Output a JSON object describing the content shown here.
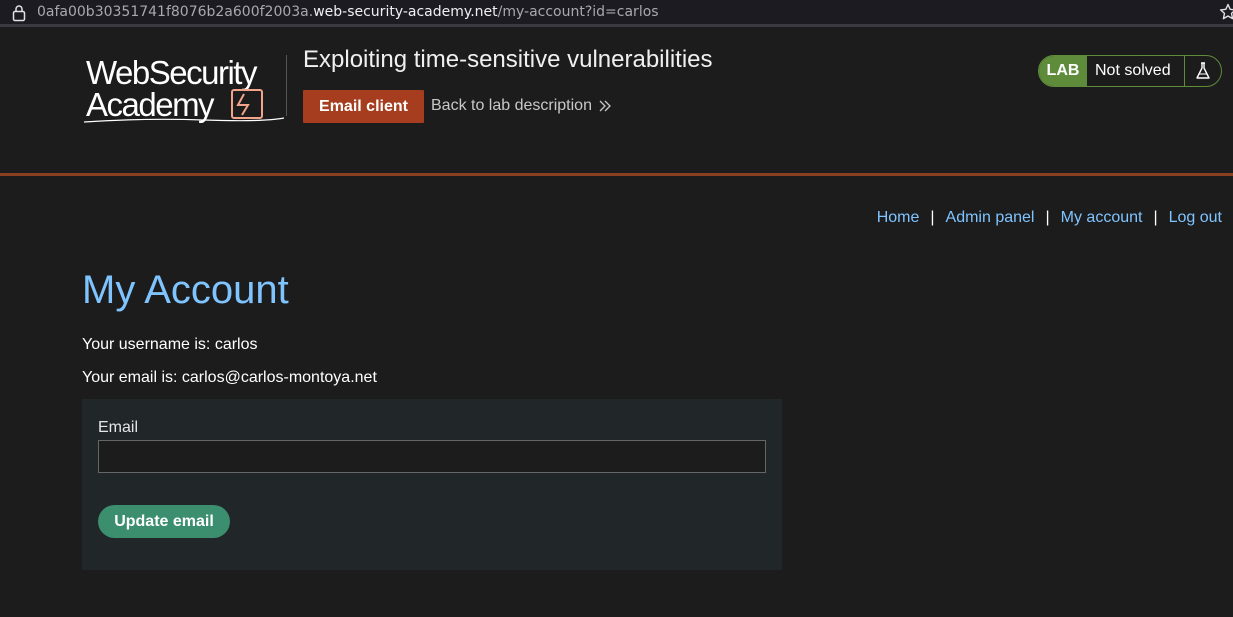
{
  "browser": {
    "url_prefix": "0afa00b30351741f8076b2a600f2003a.",
    "url_host": "web-security-academy.net",
    "url_path": "/my-account?id=carlos"
  },
  "header": {
    "logo_line1": "WebSecurity",
    "logo_line2": "Academy",
    "lab_title": "Exploiting time-sensitive vulnerabilities",
    "email_client_label": "Email client",
    "back_link_label": "Back to lab description",
    "lab_badge": "LAB",
    "lab_status": "Not solved"
  },
  "nav": {
    "home": "Home",
    "admin_panel": "Admin panel",
    "my_account": "My account",
    "log_out": "Log out",
    "separator": "|"
  },
  "main": {
    "title": "My Account",
    "username_line": "Your username is: carlos",
    "email_line": "Your email is: carlos@carlos-montoya.net",
    "form": {
      "email_label": "Email",
      "email_value": "",
      "update_label": "Update email"
    }
  },
  "colors": {
    "accent_link": "#7fc4ff",
    "email_client_button": "#a63d1e",
    "lab_badge": "#5e8c3b",
    "update_button": "#3b8f6e",
    "header_border": "#8a3f20"
  },
  "icons": {
    "lock": "lock-icon",
    "star": "star-icon",
    "chevrons": "double-chevron-right-icon",
    "flask": "flask-icon"
  }
}
